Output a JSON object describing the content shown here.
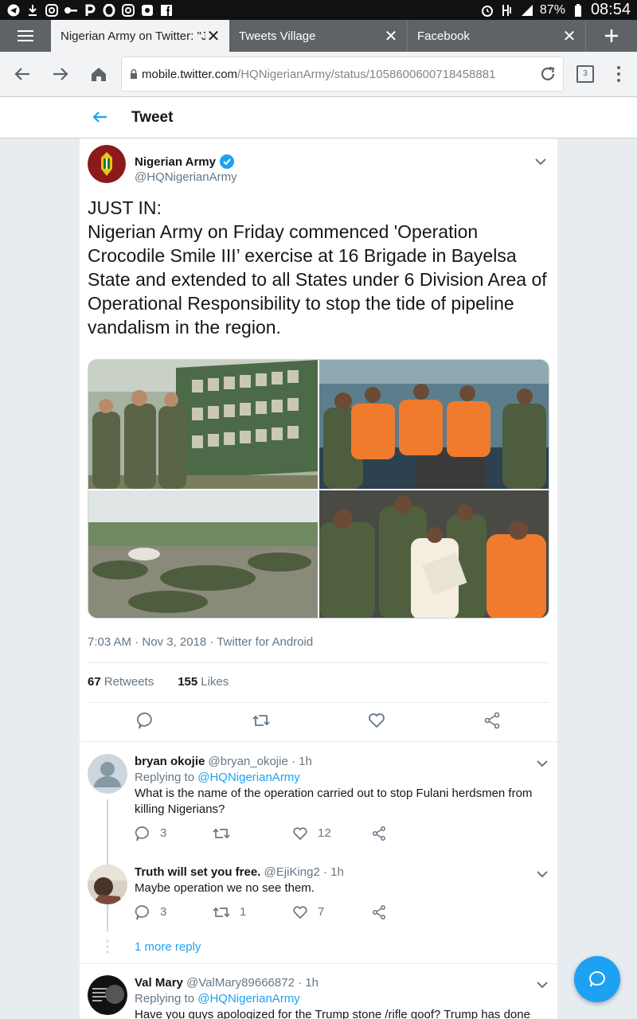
{
  "status_bar": {
    "battery": "87%",
    "time": "08:54",
    "left_icons": [
      "telegram-icon",
      "download-icon",
      "instagram-icon",
      "key-icon",
      "p-icon",
      "opera-icon",
      "instagram-icon",
      "photos-icon",
      "facebook-icon"
    ],
    "right_icons": [
      "alarm-icon",
      "data-icon",
      "signal-icon",
      "battery-icon"
    ]
  },
  "browser": {
    "tabs": [
      {
        "title": "Nigerian Army on Twitter: \"JUST IN:",
        "active": true
      },
      {
        "title": "Tweets Village",
        "active": false
      },
      {
        "title": "Facebook",
        "active": false
      }
    ],
    "url_host": "mobile.twitter.com",
    "url_path": "/HQNigerianArmy/status/1058600600718458881",
    "tab_count": "3"
  },
  "header": {
    "title": "Tweet"
  },
  "tweet": {
    "author_name": "Nigerian Army",
    "author_handle": "@HQNigerianArmy",
    "text_line1": "JUST IN:",
    "text_line2": "Nigerian Army on Friday commenced 'Operation Crocodile Smile III’ exercise at 16 Brigade in Bayelsa State and extended to all States under 6 Division Area of Operational Responsibility to stop the tide of pipeline vandalism in the region.",
    "meta": "7:03 AM · Nov 3, 2018 · Twitter for Android",
    "retweets_count": "67",
    "retweets_label": "Retweets",
    "likes_count": "155",
    "likes_label": "Likes"
  },
  "replies": [
    {
      "name": "bryan okojie",
      "handle": "@bryan_okojie · 1h",
      "replying_prefix": "Replying to",
      "replying_to": "@HQNigerianArmy",
      "text": "What is the name of the operation carried out to stop Fulani herdsmen from killing Nigerians?",
      "reply_count": "3",
      "retweet_count": "",
      "like_count": "12"
    },
    {
      "name": "Truth will set you free.",
      "handle": "@EjiKing2 · 1h",
      "text": "Maybe operation we no see them.",
      "reply_count": "3",
      "retweet_count": "1",
      "like_count": "7"
    },
    {
      "name": "Val Mary",
      "handle": "@ValMary89666872 · 1h",
      "replying_prefix": "Replying to",
      "replying_to": "@HQNigerianArmy",
      "text": "Have you guys apologized for the Trump stone /rifle goof? Trump has done"
    }
  ],
  "more_replies": "1 more reply",
  "colors": {
    "accent": "#1da1f2",
    "secondary_text": "#657786",
    "divider": "#e6ecf0"
  }
}
